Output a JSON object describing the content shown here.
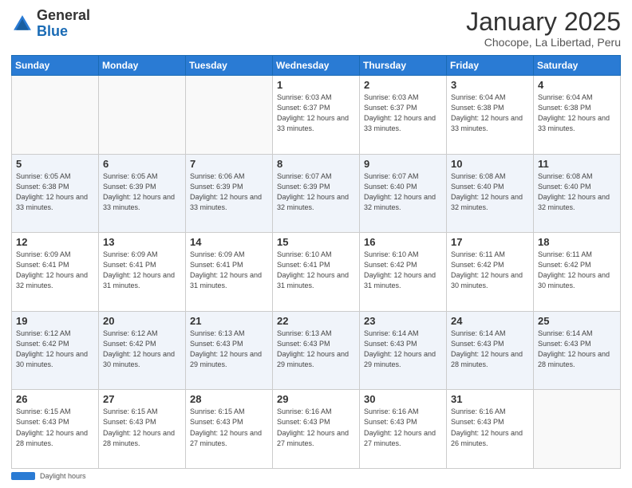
{
  "header": {
    "logo_general": "General",
    "logo_blue": "Blue",
    "month_title": "January 2025",
    "subtitle": "Chocope, La Libertad, Peru"
  },
  "days_of_week": [
    "Sunday",
    "Monday",
    "Tuesday",
    "Wednesday",
    "Thursday",
    "Friday",
    "Saturday"
  ],
  "weeks": [
    [
      {
        "day": "",
        "sunrise": "",
        "sunset": "",
        "daylight": ""
      },
      {
        "day": "",
        "sunrise": "",
        "sunset": "",
        "daylight": ""
      },
      {
        "day": "",
        "sunrise": "",
        "sunset": "",
        "daylight": ""
      },
      {
        "day": "1",
        "sunrise": "Sunrise: 6:03 AM",
        "sunset": "Sunset: 6:37 PM",
        "daylight": "Daylight: 12 hours and 33 minutes."
      },
      {
        "day": "2",
        "sunrise": "Sunrise: 6:03 AM",
        "sunset": "Sunset: 6:37 PM",
        "daylight": "Daylight: 12 hours and 33 minutes."
      },
      {
        "day": "3",
        "sunrise": "Sunrise: 6:04 AM",
        "sunset": "Sunset: 6:38 PM",
        "daylight": "Daylight: 12 hours and 33 minutes."
      },
      {
        "day": "4",
        "sunrise": "Sunrise: 6:04 AM",
        "sunset": "Sunset: 6:38 PM",
        "daylight": "Daylight: 12 hours and 33 minutes."
      }
    ],
    [
      {
        "day": "5",
        "sunrise": "Sunrise: 6:05 AM",
        "sunset": "Sunset: 6:38 PM",
        "daylight": "Daylight: 12 hours and 33 minutes."
      },
      {
        "day": "6",
        "sunrise": "Sunrise: 6:05 AM",
        "sunset": "Sunset: 6:39 PM",
        "daylight": "Daylight: 12 hours and 33 minutes."
      },
      {
        "day": "7",
        "sunrise": "Sunrise: 6:06 AM",
        "sunset": "Sunset: 6:39 PM",
        "daylight": "Daylight: 12 hours and 33 minutes."
      },
      {
        "day": "8",
        "sunrise": "Sunrise: 6:07 AM",
        "sunset": "Sunset: 6:39 PM",
        "daylight": "Daylight: 12 hours and 32 minutes."
      },
      {
        "day": "9",
        "sunrise": "Sunrise: 6:07 AM",
        "sunset": "Sunset: 6:40 PM",
        "daylight": "Daylight: 12 hours and 32 minutes."
      },
      {
        "day": "10",
        "sunrise": "Sunrise: 6:08 AM",
        "sunset": "Sunset: 6:40 PM",
        "daylight": "Daylight: 12 hours and 32 minutes."
      },
      {
        "day": "11",
        "sunrise": "Sunrise: 6:08 AM",
        "sunset": "Sunset: 6:40 PM",
        "daylight": "Daylight: 12 hours and 32 minutes."
      }
    ],
    [
      {
        "day": "12",
        "sunrise": "Sunrise: 6:09 AM",
        "sunset": "Sunset: 6:41 PM",
        "daylight": "Daylight: 12 hours and 32 minutes."
      },
      {
        "day": "13",
        "sunrise": "Sunrise: 6:09 AM",
        "sunset": "Sunset: 6:41 PM",
        "daylight": "Daylight: 12 hours and 31 minutes."
      },
      {
        "day": "14",
        "sunrise": "Sunrise: 6:09 AM",
        "sunset": "Sunset: 6:41 PM",
        "daylight": "Daylight: 12 hours and 31 minutes."
      },
      {
        "day": "15",
        "sunrise": "Sunrise: 6:10 AM",
        "sunset": "Sunset: 6:41 PM",
        "daylight": "Daylight: 12 hours and 31 minutes."
      },
      {
        "day": "16",
        "sunrise": "Sunrise: 6:10 AM",
        "sunset": "Sunset: 6:42 PM",
        "daylight": "Daylight: 12 hours and 31 minutes."
      },
      {
        "day": "17",
        "sunrise": "Sunrise: 6:11 AM",
        "sunset": "Sunset: 6:42 PM",
        "daylight": "Daylight: 12 hours and 30 minutes."
      },
      {
        "day": "18",
        "sunrise": "Sunrise: 6:11 AM",
        "sunset": "Sunset: 6:42 PM",
        "daylight": "Daylight: 12 hours and 30 minutes."
      }
    ],
    [
      {
        "day": "19",
        "sunrise": "Sunrise: 6:12 AM",
        "sunset": "Sunset: 6:42 PM",
        "daylight": "Daylight: 12 hours and 30 minutes."
      },
      {
        "day": "20",
        "sunrise": "Sunrise: 6:12 AM",
        "sunset": "Sunset: 6:42 PM",
        "daylight": "Daylight: 12 hours and 30 minutes."
      },
      {
        "day": "21",
        "sunrise": "Sunrise: 6:13 AM",
        "sunset": "Sunset: 6:43 PM",
        "daylight": "Daylight: 12 hours and 29 minutes."
      },
      {
        "day": "22",
        "sunrise": "Sunrise: 6:13 AM",
        "sunset": "Sunset: 6:43 PM",
        "daylight": "Daylight: 12 hours and 29 minutes."
      },
      {
        "day": "23",
        "sunrise": "Sunrise: 6:14 AM",
        "sunset": "Sunset: 6:43 PM",
        "daylight": "Daylight: 12 hours and 29 minutes."
      },
      {
        "day": "24",
        "sunrise": "Sunrise: 6:14 AM",
        "sunset": "Sunset: 6:43 PM",
        "daylight": "Daylight: 12 hours and 28 minutes."
      },
      {
        "day": "25",
        "sunrise": "Sunrise: 6:14 AM",
        "sunset": "Sunset: 6:43 PM",
        "daylight": "Daylight: 12 hours and 28 minutes."
      }
    ],
    [
      {
        "day": "26",
        "sunrise": "Sunrise: 6:15 AM",
        "sunset": "Sunset: 6:43 PM",
        "daylight": "Daylight: 12 hours and 28 minutes."
      },
      {
        "day": "27",
        "sunrise": "Sunrise: 6:15 AM",
        "sunset": "Sunset: 6:43 PM",
        "daylight": "Daylight: 12 hours and 28 minutes."
      },
      {
        "day": "28",
        "sunrise": "Sunrise: 6:15 AM",
        "sunset": "Sunset: 6:43 PM",
        "daylight": "Daylight: 12 hours and 27 minutes."
      },
      {
        "day": "29",
        "sunrise": "Sunrise: 6:16 AM",
        "sunset": "Sunset: 6:43 PM",
        "daylight": "Daylight: 12 hours and 27 minutes."
      },
      {
        "day": "30",
        "sunrise": "Sunrise: 6:16 AM",
        "sunset": "Sunset: 6:43 PM",
        "daylight": "Daylight: 12 hours and 27 minutes."
      },
      {
        "day": "31",
        "sunrise": "Sunrise: 6:16 AM",
        "sunset": "Sunset: 6:43 PM",
        "daylight": "Daylight: 12 hours and 26 minutes."
      },
      {
        "day": "",
        "sunrise": "",
        "sunset": "",
        "daylight": ""
      }
    ]
  ],
  "footer": {
    "daylight_label": "Daylight hours"
  }
}
